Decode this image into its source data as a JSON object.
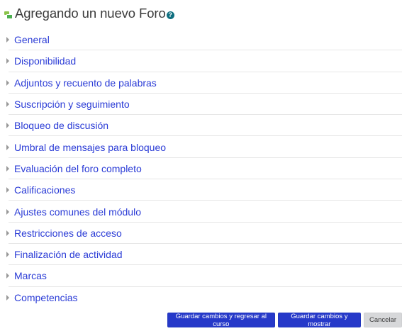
{
  "header": {
    "title": "Agregando un nuevo Foro",
    "forum_icon": "forum-icon",
    "help_icon_glyph": "?"
  },
  "sections": [
    {
      "label": "General"
    },
    {
      "label": "Disponibilidad"
    },
    {
      "label": "Adjuntos y recuento de palabras"
    },
    {
      "label": "Suscripción y seguimiento"
    },
    {
      "label": "Bloqueo de discusión"
    },
    {
      "label": "Umbral de mensajes para bloqueo"
    },
    {
      "label": "Evaluación del foro completo"
    },
    {
      "label": "Calificaciones"
    },
    {
      "label": "Ajustes comunes del módulo"
    },
    {
      "label": "Restricciones de acceso"
    },
    {
      "label": "Finalización de actividad"
    },
    {
      "label": "Marcas"
    },
    {
      "label": "Competencias"
    }
  ],
  "actions": {
    "save_return": "Guardar cambios y regresar al curso",
    "save_display": "Guardar cambios y mostrar",
    "cancel": "Cancelar"
  },
  "colors": {
    "link": "#2a3bd6",
    "primary_button": "#2639c9",
    "secondary_button": "#d7d8da",
    "help_icon": "#0f6f80"
  }
}
